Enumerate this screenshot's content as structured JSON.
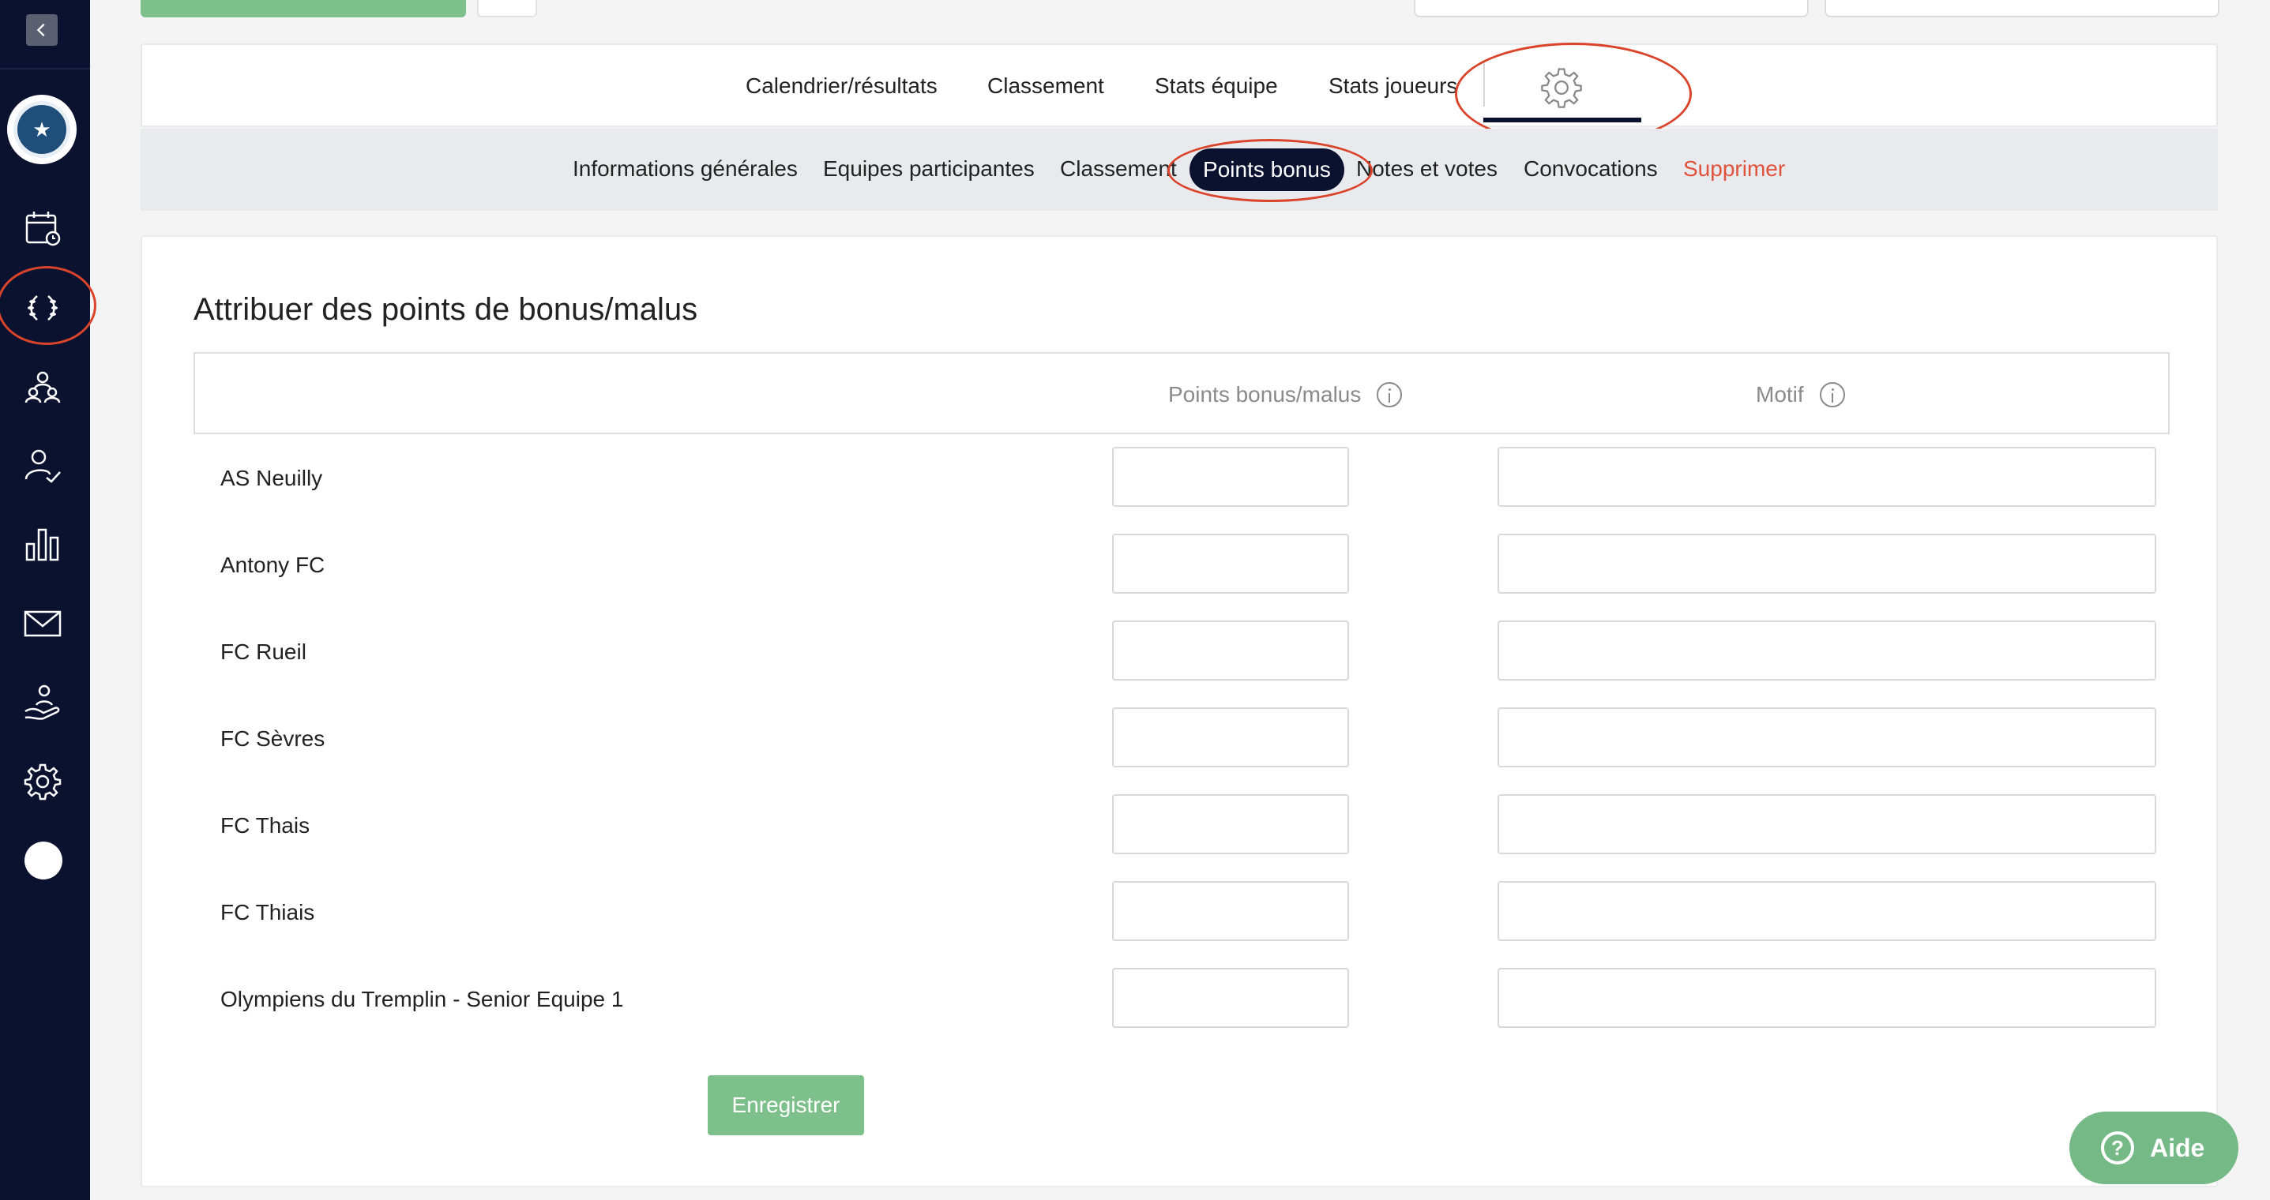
{
  "sidebar": {
    "items": [
      {
        "name": "calendar-icon"
      },
      {
        "name": "laurel-icon"
      },
      {
        "name": "team-icon"
      },
      {
        "name": "user-check-icon"
      },
      {
        "name": "bar-chart-icon"
      },
      {
        "name": "mail-icon"
      },
      {
        "name": "hand-user-icon"
      },
      {
        "name": "gear-icon"
      }
    ]
  },
  "main_tabs": [
    {
      "label": "Calendrier/résultats"
    },
    {
      "label": "Classement"
    },
    {
      "label": "Stats équipe"
    },
    {
      "label": "Stats joueurs"
    }
  ],
  "sub_tabs": [
    {
      "label": "Informations générales"
    },
    {
      "label": "Equipes participantes"
    },
    {
      "label": "Classement"
    },
    {
      "label": "Points bonus"
    },
    {
      "label": "Notes et votes"
    },
    {
      "label": "Convocations"
    },
    {
      "label": "Supprimer"
    }
  ],
  "form": {
    "title": "Attribuer des points de bonus/malus",
    "col_points": "Points bonus/malus",
    "col_motif": "Motif",
    "teams": [
      {
        "name": "AS Neuilly",
        "points": "",
        "motif": ""
      },
      {
        "name": "Antony FC",
        "points": "",
        "motif": ""
      },
      {
        "name": "FC Rueil",
        "points": "",
        "motif": ""
      },
      {
        "name": "FC Sèvres",
        "points": "",
        "motif": ""
      },
      {
        "name": "FC Thais",
        "points": "",
        "motif": ""
      },
      {
        "name": "FC Thiais",
        "points": "",
        "motif": ""
      },
      {
        "name": "Olympiens du Tremplin - Senior Equipe 1",
        "points": "",
        "motif": ""
      }
    ],
    "save_label": "Enregistrer"
  },
  "help": {
    "label": "Aide"
  },
  "colors": {
    "sidebar_bg": "#0a1230",
    "accent_green": "#7ec08c",
    "danger": "#e0523a",
    "annotation": "#d9442b"
  }
}
